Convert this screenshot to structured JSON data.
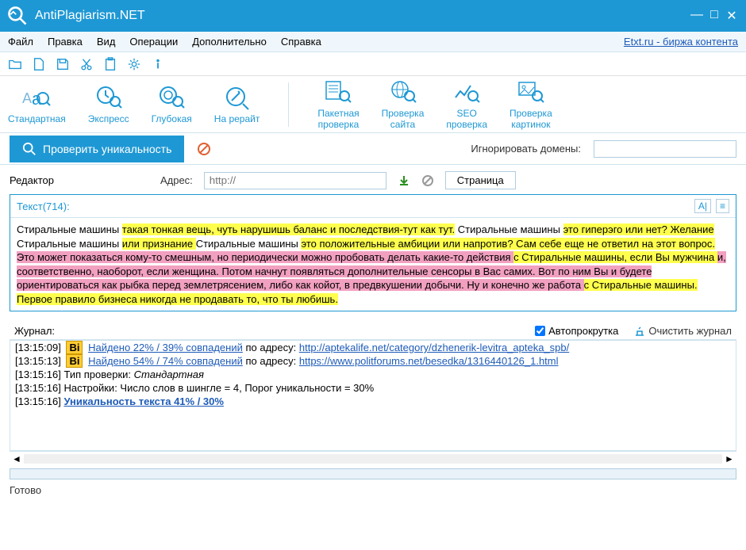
{
  "title": "AntiPlagiarism.NET",
  "menubar": {
    "items": [
      "Файл",
      "Правка",
      "Вид",
      "Операции",
      "Дополнительно",
      "Справка"
    ],
    "right_link": "Etxt.ru - биржа контента"
  },
  "ribbon": {
    "left": [
      {
        "label": "Стандартная"
      },
      {
        "label": "Экспресс"
      },
      {
        "label": "Глубокая"
      },
      {
        "label": "На рерайт"
      }
    ],
    "right": [
      {
        "label": "Пакетная\nпроверка"
      },
      {
        "label": "Проверка\nсайта"
      },
      {
        "label": "SEO\nпроверка"
      },
      {
        "label": "Проверка\nкартинок"
      }
    ]
  },
  "action": {
    "check_label": "Проверить уникальность",
    "ignore_label": "Игнорировать домены:",
    "ignore_value": ""
  },
  "editor": {
    "label": "Редактор",
    "addr_label": "Адрес:",
    "addr_placeholder": "http://",
    "page_tab": "Страница",
    "text_label": "Текст(714):",
    "segments": [
      {
        "t": "Стиральные машины ",
        "c": ""
      },
      {
        "t": "такая тонкая вещь, чуть нарушишь баланс и последствия-тут как тут.",
        "c": "hl-y"
      },
      {
        "t": " Стиральные машины ",
        "c": ""
      },
      {
        "t": "это гиперэго или нет? Желание ",
        "c": "hl-y"
      },
      {
        "t": "Стиральные машины ",
        "c": ""
      },
      {
        "t": "или признание ",
        "c": "hl-y"
      },
      {
        "t": "Стиральные машины ",
        "c": ""
      },
      {
        "t": "это положительные амбиции или напротив? Сам себе еще не ответил на этот вопрос.",
        "c": "hl-y"
      },
      {
        "t": " Это может показаться кому-то смешным, но периодически можно пробовать делать какие-то действия ",
        "c": "hl-p"
      },
      {
        "t": "с Стиральные машины, если Вы мужчина ",
        "c": "hl-y"
      },
      {
        "t": "и, соответственно, наоборот, если женщина. Потом начнут появляться дополнительные сенсоры в Вас самих. Вот по ним Вы и будете ориентироваться как рыбка перед землетрясением, либо как койот, в предвкушении добычи. Ну и конечно же работа ",
        "c": "hl-p"
      },
      {
        "t": "с Стиральные машины.",
        "c": "hl-y"
      },
      {
        "t": " Первое правило бизнеса никогда не продавать то, что ты любишь.",
        "c": "hl-y"
      }
    ]
  },
  "log": {
    "label": "Журнал:",
    "autoscroll": "Автопрокрутка",
    "clear": "Очистить журнал",
    "lines": [
      {
        "ts": "[13:15:09]",
        "bi": true,
        "found": "Найдено 22% / 39% совпадений",
        "mid": " по адресу: ",
        "url": "http://aptekalife.net/category/dzhenerik-levitra_apteka_spb/"
      },
      {
        "ts": "[13:15:13]",
        "bi": true,
        "found": "Найдено 54% / 74% совпадений",
        "mid": " по адресу: ",
        "url": "https://www.politforums.net/besedka/1316440126_1.html"
      },
      {
        "ts": "[13:15:16]",
        "plain1": "Тип проверки: ",
        "italic": "Стандартная"
      },
      {
        "ts": "[13:15:16]",
        "plain1": "Настройки: Число слов в шингле = 4, Порог уникальности = 30%"
      },
      {
        "ts": "[13:15:16]",
        "boldlink": "Уникальность текста 41% / 30%"
      }
    ]
  },
  "status": "Готово"
}
